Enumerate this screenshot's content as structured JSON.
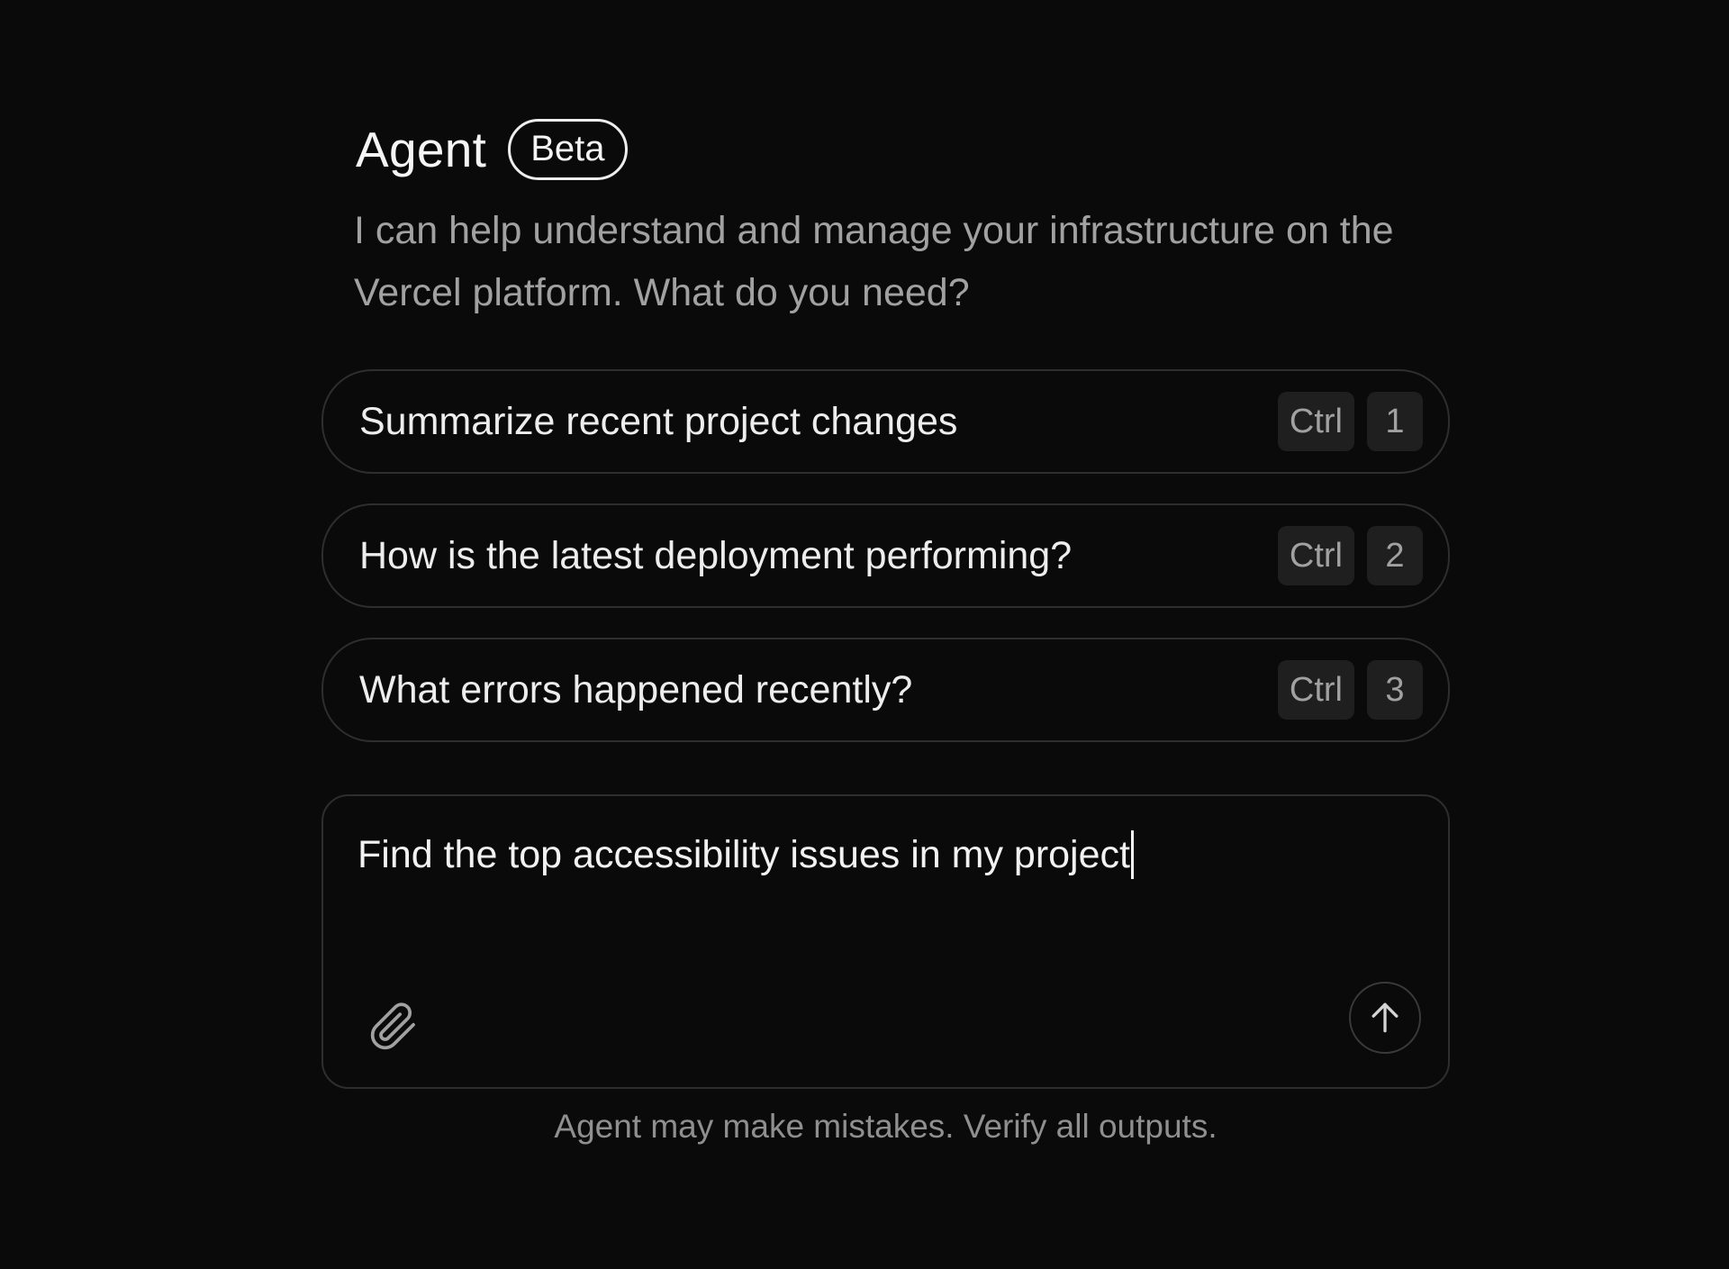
{
  "header": {
    "title": "Agent",
    "badge": "Beta",
    "subtitle": "I can help understand and manage your infrastructure on the Vercel platform. What do you need?"
  },
  "suggestions": [
    {
      "label": "Summarize recent project changes",
      "modifier": "Ctrl",
      "key": "1"
    },
    {
      "label": "How is the latest deployment performing?",
      "modifier": "Ctrl",
      "key": "2"
    },
    {
      "label": "What errors happened recently?",
      "modifier": "Ctrl",
      "key": "3"
    }
  ],
  "composer": {
    "value": "Find the top accessibility issues in my project",
    "attach_icon": "paperclip-icon",
    "send_icon": "arrow-up-icon"
  },
  "footer": {
    "disclaimer": "Agent may make mistakes. Verify all outputs."
  },
  "colors": {
    "background": "#0a0a0a",
    "border": "#2e2e2e",
    "text_primary": "#ededed",
    "text_secondary": "#a1a1a1",
    "key_background": "#1f1f1f"
  }
}
